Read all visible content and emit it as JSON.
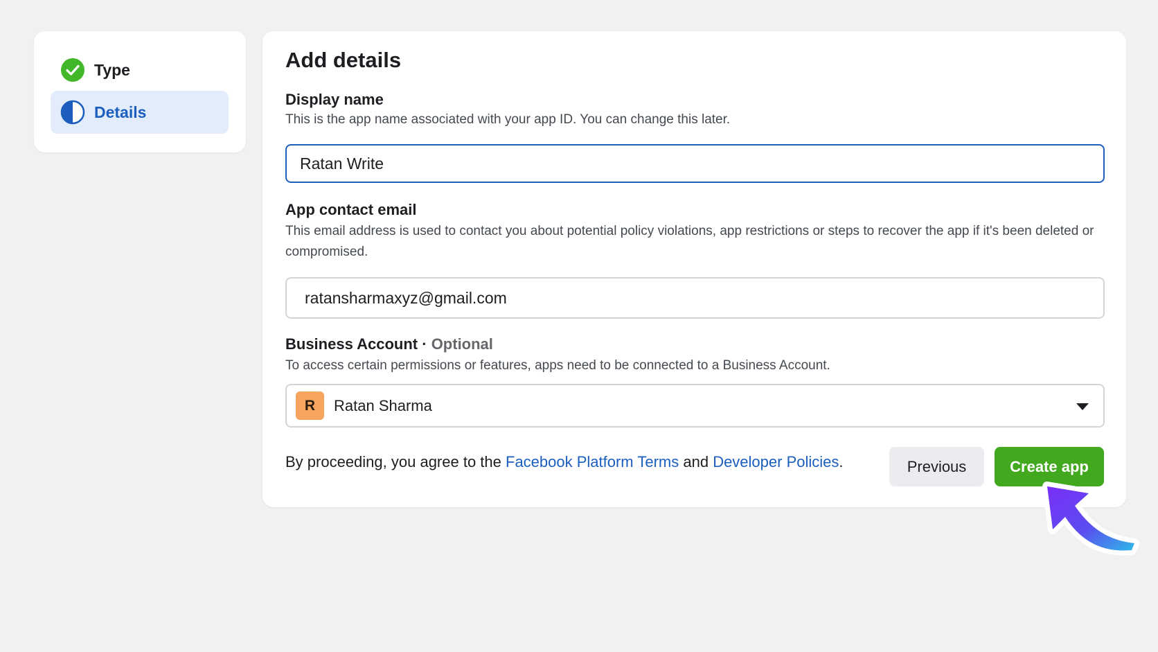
{
  "steps": {
    "items": [
      {
        "label": "Type",
        "status": "complete",
        "icon": "check-circle-icon"
      },
      {
        "label": "Details",
        "status": "in-progress",
        "icon": "half-circle-icon"
      }
    ]
  },
  "form": {
    "title": "Add details",
    "display_name": {
      "label": "Display name",
      "help": "This is the app name associated with your app ID. You can change this later.",
      "value": "Ratan Write"
    },
    "contact_email": {
      "label": "App contact email",
      "help": "This email address is used to contact you about potential policy violations, app restrictions or steps to recover the app if it's been deleted or compromised.",
      "value": "ratansharmaxyz@gmail.com"
    },
    "business_account": {
      "label": "Business Account",
      "separator": " · ",
      "optional": "Optional",
      "help": "To access certain permissions or features, apps need to be connected to a Business Account.",
      "avatar_initial": "R",
      "selected": "Ratan Sharma"
    },
    "terms": {
      "prefix": "By proceeding, you agree to the ",
      "link1": "Facebook Platform Terms",
      "middle": " and ",
      "link2": "Developer Policies",
      "suffix": "."
    },
    "buttons": {
      "previous": "Previous",
      "create": "Create app"
    }
  },
  "colors": {
    "accent_blue": "#1b5ebd",
    "success_green": "#42a81e",
    "avatar_orange": "#f6a55f"
  }
}
